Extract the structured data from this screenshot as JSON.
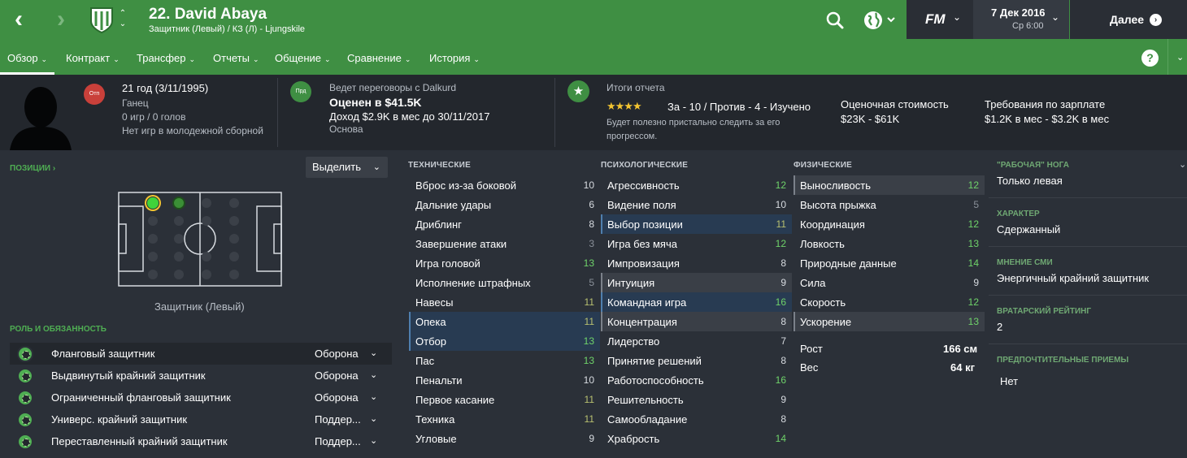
{
  "header": {
    "player_name": "22. David Abaya",
    "player_sub": "Защитник (Левый) / КЗ (Л) - Ljungskile",
    "date_main": "7 Дек 2016",
    "date_sub": "Ср 6:00",
    "continue_label": "Далее",
    "fm_logo": "FM",
    "help": "?"
  },
  "tabs": [
    "Обзор",
    "Контракт",
    "Трансфер",
    "Отчеты",
    "Общение",
    "Сравнение",
    "История"
  ],
  "info": {
    "age": "21 год (3/11/1995)",
    "nationality": "Ганец",
    "caps": "0 игр / 0 голов",
    "youth": "Нет игр в молодежной сборной",
    "badge1": "Отп",
    "badge2": "Прд",
    "negotiation": "Ведет переговоры с Dalkurd",
    "value": "Оценен в $41.5K",
    "wage": "Доход $2.9K в мес до 30/11/2017",
    "squad": "Основа",
    "report_title": "Итоги отчета",
    "report_stats": "За - 10 / Против - 4 - Изучено",
    "report_note_1": "Будет полезно пристально следить за его",
    "report_note_2": "прогрессом.",
    "est_value_label": "Оценочная стоимость",
    "est_value": "$23K - $61K",
    "wage_demand_label": "Требования по зарплате",
    "wage_demand": "$1.2K в мес - $3.2K в мес",
    "star_rating": 4
  },
  "left": {
    "positions_title": "ПОЗИЦИИ ›",
    "select_label": "Выделить",
    "pitch_label": "Защитник (Левый)",
    "roles_title": "РОЛЬ И ОБЯЗАННОСТЬ",
    "roles": [
      {
        "name": "Фланговый защитник",
        "duty": "Оборона"
      },
      {
        "name": "Выдвинутый крайний защитник",
        "duty": "Оборона"
      },
      {
        "name": "Ограниченный фланговый защитник",
        "duty": "Оборона"
      },
      {
        "name": "Универс. крайний защитник",
        "duty": "Поддер..."
      },
      {
        "name": "Переставленный крайний защитник",
        "duty": "Поддер..."
      }
    ]
  },
  "attributes": {
    "technical_title": "ТЕХНИЧЕСКИЕ",
    "mental_title": "ПСИХОЛОГИЧЕСКИЕ",
    "physical_title": "ФИЗИЧЕСКИЕ",
    "technical": [
      {
        "name": "Вброс из-за боковой",
        "value": "10"
      },
      {
        "name": "Дальние удары",
        "value": "6"
      },
      {
        "name": "Дриблинг",
        "value": "8"
      },
      {
        "name": "Завершение атаки",
        "value": "3"
      },
      {
        "name": "Игра головой",
        "value": "13"
      },
      {
        "name": "Исполнение штрафных",
        "value": "5"
      },
      {
        "name": "Навесы",
        "value": "11"
      },
      {
        "name": "Опека",
        "value": "11"
      },
      {
        "name": "Отбор",
        "value": "13"
      },
      {
        "name": "Пас",
        "value": "13"
      },
      {
        "name": "Пенальти",
        "value": "10"
      },
      {
        "name": "Первое касание",
        "value": "11"
      },
      {
        "name": "Техника",
        "value": "11"
      },
      {
        "name": "Угловые",
        "value": "9"
      }
    ],
    "mental": [
      {
        "name": "Агрессивность",
        "value": "12"
      },
      {
        "name": "Видение поля",
        "value": "10"
      },
      {
        "name": "Выбор позиции",
        "value": "11"
      },
      {
        "name": "Игра без мяча",
        "value": "12"
      },
      {
        "name": "Импровизация",
        "value": "8"
      },
      {
        "name": "Интуиция",
        "value": "9"
      },
      {
        "name": "Командная игра",
        "value": "16"
      },
      {
        "name": "Концентрация",
        "value": "8"
      },
      {
        "name": "Лидерство",
        "value": "7"
      },
      {
        "name": "Принятие решений",
        "value": "8"
      },
      {
        "name": "Работоспособность",
        "value": "16"
      },
      {
        "name": "Решительность",
        "value": "9"
      },
      {
        "name": "Самообладание",
        "value": "8"
      },
      {
        "name": "Храбрость",
        "value": "14"
      }
    ],
    "physical": [
      {
        "name": "Выносливость",
        "value": "12"
      },
      {
        "name": "Высота прыжка",
        "value": "5"
      },
      {
        "name": "Координация",
        "value": "12"
      },
      {
        "name": "Ловкость",
        "value": "13"
      },
      {
        "name": "Природные данные",
        "value": "14"
      },
      {
        "name": "Сила",
        "value": "9"
      },
      {
        "name": "Скорость",
        "value": "12"
      },
      {
        "name": "Ускорение",
        "value": "13"
      }
    ],
    "height_label": "Рост",
    "height": "166 см",
    "weight_label": "Вес",
    "weight": "64 кг"
  },
  "right": {
    "foot_title": "\"РАБОЧАЯ\" НОГА",
    "foot": "Только левая",
    "personality_title": "ХАРАКТЕР",
    "personality": "Сдержанный",
    "media_title": "МНЕНИЕ СМИ",
    "media": "Энергичный крайний защитник",
    "gk_title": "ВРАТАРСКИЙ РЕЙТИНГ",
    "gk": "2",
    "ppm_title": "ПРЕДПОЧТИТЕЛЬНЫЕ ПРИЕМЫ",
    "ppm": "Нет"
  },
  "colors": {
    "brand_green": "#3f8f43",
    "background": "#2b3038",
    "info_strip": "#23272d"
  }
}
